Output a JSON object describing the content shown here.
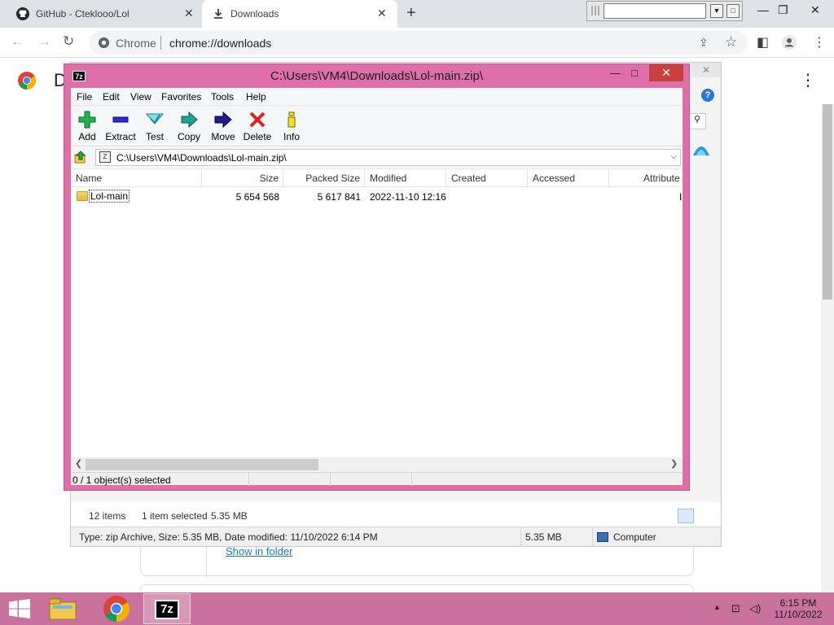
{
  "browser": {
    "tabs": [
      {
        "title": "GitHub - Cteklooo/Lol"
      },
      {
        "title": "Downloads"
      }
    ],
    "new_tab": "+",
    "omnibox": {
      "site": "Chrome",
      "url": "chrome://downloads"
    },
    "page_title_clip": "D",
    "show_in_folder": "Show in folder"
  },
  "explorer": {
    "status_items": "12 items",
    "status_selected": "1 item selected",
    "status_size": "5.35 MB",
    "details": "Type: zip Archive, Size: 5.35 MB, Date modified: 11/10/2022 6:14 PM",
    "details_size": "5.35 MB",
    "details_location": "Computer"
  },
  "sevenzip": {
    "title": "C:\\Users\\VM4\\Downloads\\Lol-main.zip\\",
    "app_icon": "7z",
    "menu": [
      "File",
      "Edit",
      "View",
      "Favorites",
      "Tools",
      "Help"
    ],
    "toolbar": [
      "Add",
      "Extract",
      "Test",
      "Copy",
      "Move",
      "Delete",
      "Info"
    ],
    "address": "C:\\Users\\VM4\\Downloads\\Lol-main.zip\\",
    "columns": [
      "Name",
      "Size",
      "Packed Size",
      "Modified",
      "Created",
      "Accessed",
      "Attribute"
    ],
    "rows": [
      {
        "name": "Lol-main",
        "size": "5 654 568",
        "packed": "5 617 841",
        "modified": "2022-11-10 12:16",
        "created": "",
        "accessed": "",
        "attr": "I"
      }
    ],
    "status": "0 / 1 object(s) selected"
  },
  "taskbar": {
    "clock_time": "6:15 PM",
    "clock_date": "11/10/2022",
    "sevenzip_label": "7z"
  },
  "colors": {
    "window_frame": "#de6fa9",
    "taskbar": "#c9729e",
    "close_button": "#c7413e",
    "link": "#1a73e8"
  },
  "icons": [
    "github-icon",
    "download-icon",
    "chrome-icon",
    "folder-icon",
    "add-icon",
    "extract-icon",
    "test-icon",
    "copy-icon",
    "move-icon",
    "delete-icon",
    "info-icon",
    "up-folder-icon",
    "windows-icon",
    "file-explorer-icon"
  ]
}
